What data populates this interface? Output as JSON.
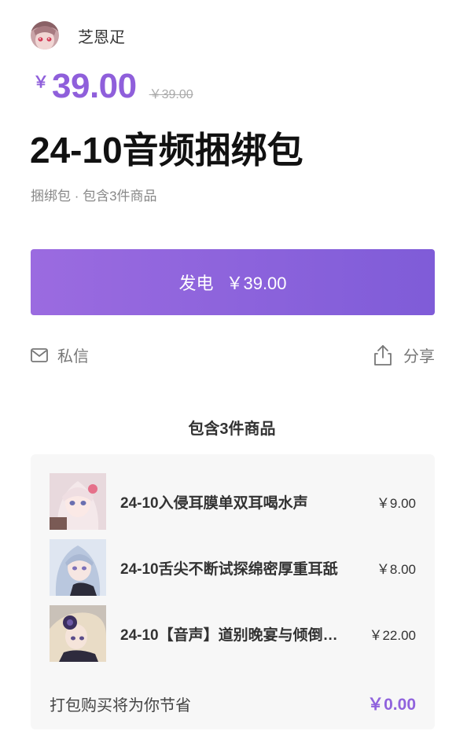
{
  "author": {
    "name": "芝恩疋",
    "avatar_icon": "anime-girl-avatar"
  },
  "price": {
    "currency": "￥",
    "current": "39.00",
    "original": "￥39.00"
  },
  "product": {
    "title": "24-10音频捆绑包",
    "subtitle": "捆绑包 · 包含3件商品"
  },
  "buy_button": {
    "label": "发电",
    "price": "￥39.00"
  },
  "actions": {
    "message_label": "私信",
    "share_label": "分享"
  },
  "bundle": {
    "heading": "包含3件商品",
    "items": [
      {
        "name": "24-10入侵耳膜单双耳喝水声",
        "price": "￥9.00"
      },
      {
        "name": "24-10舌尖不断试探绵密厚重耳舐",
        "price": "￥8.00"
      },
      {
        "name": "24-10【音声】道别晚宴与倾倒…",
        "price": "￥22.00"
      }
    ],
    "saving_label": "打包购买将为你节省",
    "saving_amount": "￥0.00"
  },
  "colors": {
    "accent": "#8f5fdb",
    "button_start": "#9b6be0",
    "button_end": "#7f5cd8",
    "card_bg": "#f7f7f7"
  }
}
